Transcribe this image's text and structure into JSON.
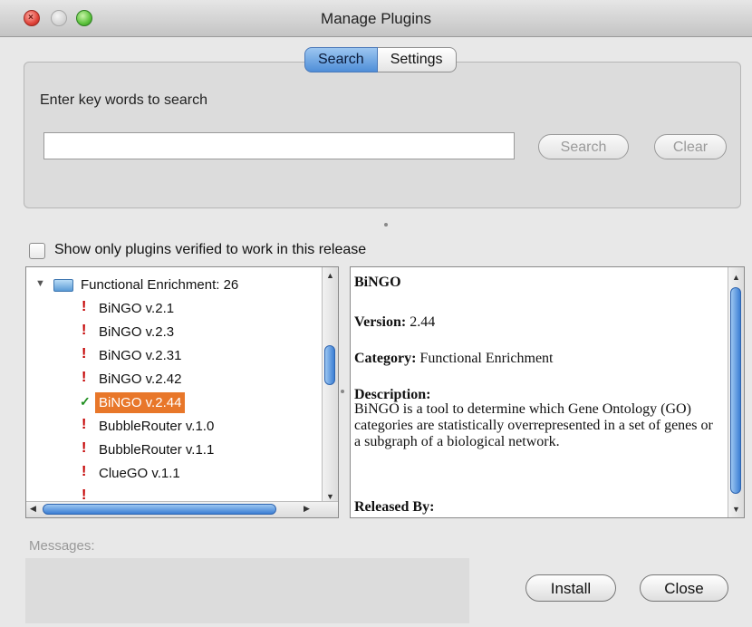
{
  "window": {
    "title": "Manage Plugins"
  },
  "tabs": [
    {
      "label": "Search",
      "active": true
    },
    {
      "label": "Settings",
      "active": false
    }
  ],
  "search": {
    "prompt": "Enter key words to search",
    "value": "",
    "search_button": "Search",
    "clear_button": "Clear"
  },
  "filter": {
    "label": "Show only plugins verified to work in this release",
    "checked": false
  },
  "tree": {
    "category": "Functional Enrichment: 26",
    "items": [
      {
        "label": "BiNGO v.2.1",
        "status": "warning"
      },
      {
        "label": "BiNGO v.2.3",
        "status": "warning"
      },
      {
        "label": "BiNGO v.2.31",
        "status": "warning"
      },
      {
        "label": "BiNGO v.2.42",
        "status": "warning"
      },
      {
        "label": "BiNGO v.2.44",
        "status": "verified",
        "selected": true
      },
      {
        "label": "BubbleRouter v.1.0",
        "status": "warning"
      },
      {
        "label": "BubbleRouter v.1.1",
        "status": "warning"
      },
      {
        "label": "ClueGO v.1.1",
        "status": "warning"
      }
    ]
  },
  "detail": {
    "name": "BiNGO",
    "version_label": "Version:",
    "version": "2.44",
    "category_label": "Category:",
    "category": "Functional Enrichment",
    "description_label": "Description:",
    "description": "BiNGO is a tool to determine which Gene Ontology (GO) categories are statistically overrepresented in a set of genes or a subgraph of a biological network.",
    "released_by_label": "Released By:"
  },
  "messages": {
    "label": "Messages:"
  },
  "buttons": {
    "install": "Install",
    "close": "Close"
  },
  "colors": {
    "accent": "#3b7ed3",
    "selection": "#e8772a",
    "warning": "#c40000",
    "verified": "#1e8e1e"
  }
}
